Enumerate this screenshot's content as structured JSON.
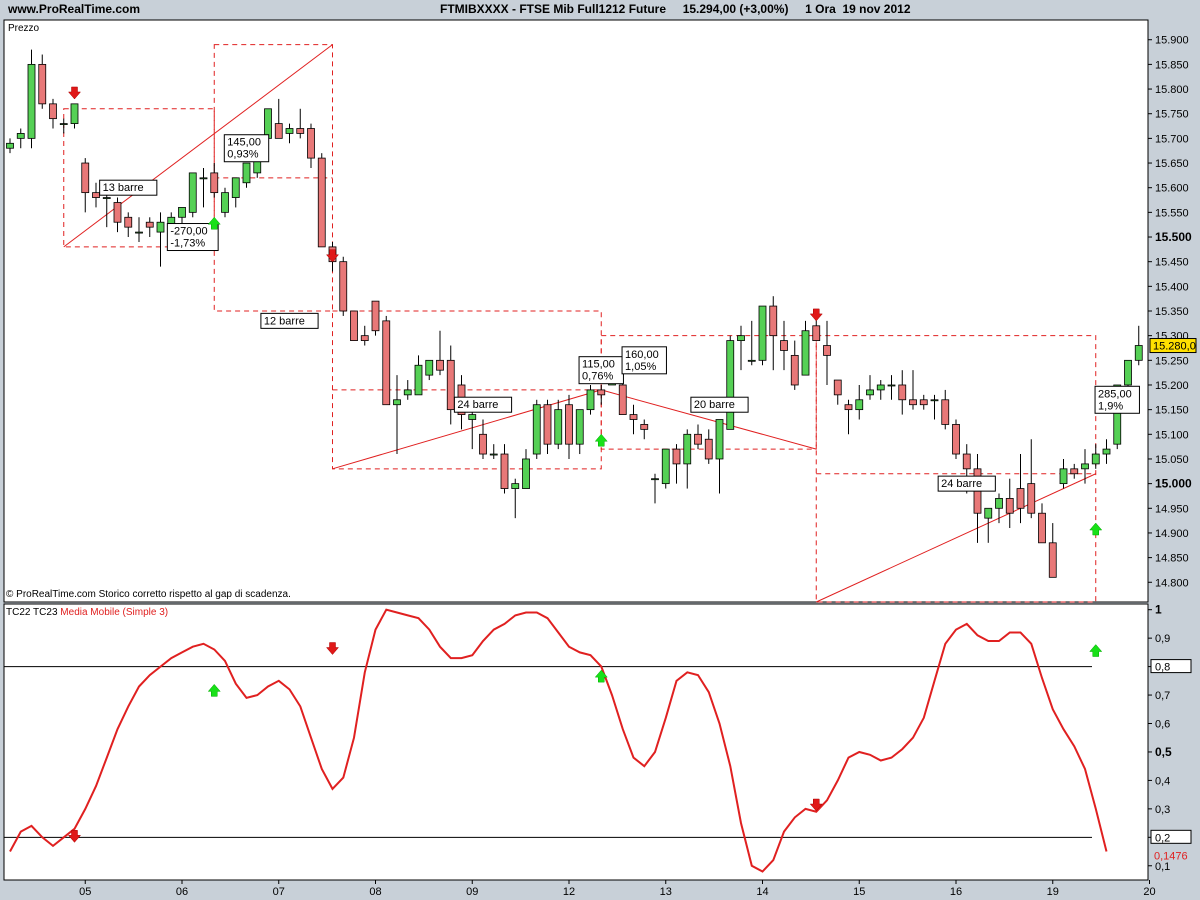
{
  "header": {
    "site": "www.ProRealTime.com",
    "title": "FTMIBXXXX - FTSE Mib Full1212 Future     15.294,00 (+3,00%)     1 Ora  19 nov 2012"
  },
  "colors": {
    "up": "#55d055",
    "down": "#e87878",
    "line": "#e02020",
    "dash": "#e02020",
    "panel": "#ffffff",
    "outer": "#c8d0d8"
  },
  "chart_data": [
    {
      "type": "candlestick",
      "panel_label": "Prezzo",
      "footer_note": "© ProRealTime.com  Storico corretto rispetto al gap di scadenza.",
      "ylim": [
        14760,
        15940
      ],
      "y_ticks": [
        "15.900",
        "15.850",
        "15.800",
        "15.750",
        "15.700",
        "15.650",
        "15.600",
        "15.550",
        "15.500",
        "15.450",
        "15.400",
        "15.350",
        "15.300",
        "15.250",
        "15.200",
        "15.150",
        "15.100",
        "15.050",
        "15.000",
        "14.950",
        "14.900",
        "14.850",
        "14.800"
      ],
      "y_tick_values": [
        15900,
        15850,
        15800,
        15750,
        15700,
        15650,
        15600,
        15550,
        15500,
        15450,
        15400,
        15350,
        15300,
        15250,
        15200,
        15150,
        15100,
        15050,
        15000,
        14950,
        14900,
        14850,
        14800
      ],
      "bold_ticks": [
        "15.500",
        "15.000"
      ],
      "last_price_label": "15.280,0",
      "last_price": 15280,
      "x_labels": [
        "05",
        "06",
        "07",
        "08",
        "09",
        "12",
        "13",
        "14",
        "15",
        "16",
        "19",
        "20"
      ],
      "candles": [
        [
          15680,
          15700,
          15670,
          15690
        ],
        [
          15700,
          15720,
          15680,
          15710
        ],
        [
          15700,
          15880,
          15680,
          15850
        ],
        [
          15850,
          15870,
          15760,
          15770
        ],
        [
          15770,
          15780,
          15720,
          15740
        ],
        [
          15730,
          15740,
          15710,
          15730
        ],
        [
          15730,
          15770,
          15720,
          15770
        ],
        [
          15650,
          15660,
          15550,
          15590
        ],
        [
          15590,
          15610,
          15560,
          15580
        ],
        [
          15580,
          15590,
          15520,
          15580
        ],
        [
          15570,
          15580,
          15510,
          15530
        ],
        [
          15540,
          15550,
          15500,
          15520
        ],
        [
          15510,
          15540,
          15490,
          15510
        ],
        [
          15530,
          15540,
          15500,
          15520
        ],
        [
          15510,
          15550,
          15440,
          15530
        ],
        [
          15520,
          15550,
          15490,
          15540
        ],
        [
          15540,
          15560,
          15520,
          15560
        ],
        [
          15550,
          15620,
          15540,
          15630
        ],
        [
          15620,
          15640,
          15560,
          15620
        ],
        [
          15630,
          15650,
          15580,
          15590
        ],
        [
          15550,
          15600,
          15540,
          15590
        ],
        [
          15580,
          15620,
          15560,
          15620
        ],
        [
          15610,
          15650,
          15600,
          15650
        ],
        [
          15630,
          15690,
          15620,
          15680
        ],
        [
          15700,
          15760,
          15690,
          15760
        ],
        [
          15730,
          15780,
          15700,
          15700
        ],
        [
          15710,
          15730,
          15690,
          15720
        ],
        [
          15720,
          15760,
          15700,
          15710
        ],
        [
          15720,
          15730,
          15640,
          15660
        ],
        [
          15660,
          15670,
          15480,
          15480
        ],
        [
          15480,
          15490,
          15430,
          15450
        ],
        [
          15450,
          15460,
          15340,
          15350
        ],
        [
          15350,
          15350,
          15290,
          15290
        ],
        [
          15300,
          15320,
          15280,
          15290
        ],
        [
          15370,
          15370,
          15300,
          15310
        ],
        [
          15330,
          15340,
          15170,
          15160
        ],
        [
          15160,
          15220,
          15060,
          15170
        ],
        [
          15180,
          15210,
          15170,
          15190
        ],
        [
          15180,
          15260,
          15180,
          15240
        ],
        [
          15220,
          15250,
          15210,
          15250
        ],
        [
          15250,
          15310,
          15220,
          15230
        ],
        [
          15250,
          15280,
          15120,
          15150
        ],
        [
          15200,
          15220,
          15110,
          15140
        ],
        [
          15130,
          15170,
          15070,
          15140
        ],
        [
          15100,
          15130,
          15050,
          15060
        ],
        [
          15060,
          15080,
          15050,
          15060
        ],
        [
          15060,
          15080,
          14980,
          14990
        ],
        [
          14990,
          15010,
          14930,
          15000
        ],
        [
          14990,
          15070,
          14990,
          15050
        ],
        [
          15060,
          15170,
          15050,
          15160
        ],
        [
          15160,
          15170,
          15060,
          15080
        ],
        [
          15080,
          15170,
          15070,
          15150
        ],
        [
          15160,
          15180,
          15050,
          15080
        ],
        [
          15080,
          15120,
          15060,
          15150
        ],
        [
          15150,
          15200,
          15140,
          15190
        ],
        [
          15190,
          15200,
          15160,
          15180
        ],
        [
          15200,
          15240,
          15200,
          15220
        ],
        [
          15200,
          15230,
          15140,
          15140
        ],
        [
          15140,
          15160,
          15100,
          15130
        ],
        [
          15120,
          15130,
          15090,
          15110
        ],
        [
          15010,
          15020,
          14960,
          15010
        ],
        [
          15000,
          15060,
          14990,
          15070
        ],
        [
          15070,
          15080,
          15000,
          15040
        ],
        [
          15040,
          15110,
          14990,
          15100
        ],
        [
          15100,
          15120,
          15070,
          15080
        ],
        [
          15090,
          15110,
          15040,
          15050
        ],
        [
          15050,
          15130,
          14980,
          15130
        ],
        [
          15110,
          15300,
          15110,
          15290
        ],
        [
          15290,
          15320,
          15230,
          15300
        ],
        [
          15250,
          15330,
          15240,
          15250
        ],
        [
          15250,
          15350,
          15240,
          15360
        ],
        [
          15360,
          15380,
          15230,
          15300
        ],
        [
          15290,
          15330,
          15230,
          15270
        ],
        [
          15260,
          15290,
          15190,
          15200
        ],
        [
          15220,
          15330,
          15220,
          15310
        ],
        [
          15320,
          15350,
          15290,
          15290
        ],
        [
          15280,
          15330,
          15200,
          15260
        ],
        [
          15210,
          15210,
          15160,
          15180
        ],
        [
          15160,
          15170,
          15100,
          15150
        ],
        [
          15150,
          15200,
          15130,
          15170
        ],
        [
          15180,
          15220,
          15170,
          15190
        ],
        [
          15190,
          15210,
          15170,
          15200
        ],
        [
          15200,
          15220,
          15170,
          15200
        ],
        [
          15200,
          15230,
          15140,
          15170
        ],
        [
          15170,
          15230,
          15150,
          15160
        ],
        [
          15170,
          15180,
          15150,
          15160
        ],
        [
          15170,
          15180,
          15130,
          15170
        ],
        [
          15170,
          15190,
          15110,
          15120
        ],
        [
          15120,
          15130,
          15050,
          15060
        ],
        [
          15060,
          15080,
          14980,
          15030
        ],
        [
          15030,
          15060,
          14880,
          14940
        ],
        [
          14930,
          14950,
          14880,
          14950
        ],
        [
          14950,
          14980,
          14920,
          14970
        ],
        [
          14970,
          15010,
          14910,
          14940
        ],
        [
          14990,
          15060,
          14920,
          14950
        ],
        [
          15000,
          15090,
          14930,
          14940
        ],
        [
          14940,
          14960,
          14880,
          14880
        ],
        [
          14880,
          14920,
          14830,
          14810
        ],
        [
          15000,
          15050,
          14990,
          15030
        ],
        [
          15030,
          15040,
          15010,
          15020
        ],
        [
          15030,
          15070,
          15000,
          15040
        ],
        [
          15040,
          15080,
          15030,
          15060
        ],
        [
          15060,
          15090,
          15040,
          15070
        ],
        [
          15080,
          15200,
          15070,
          15200
        ],
        [
          15200,
          15250,
          15190,
          15250
        ],
        [
          15250,
          15320,
          15240,
          15280
        ]
      ],
      "annotations": [
        {
          "lines": [
            "13 barre"
          ]
        },
        {
          "lines": [
            "145,00",
            "0,93%"
          ]
        },
        {
          "lines": [
            "-270,00",
            "-1,73%"
          ]
        },
        {
          "lines": [
            "12 barre"
          ]
        },
        {
          "lines": [
            "115,00",
            "0,76%"
          ]
        },
        {
          "lines": [
            "160,00",
            "1,05%"
          ]
        },
        {
          "lines": [
            "24 barre"
          ]
        },
        {
          "lines": [
            "20 barre"
          ]
        },
        {
          "lines": [
            "285,00",
            "1,9%"
          ]
        },
        {
          "lines": [
            "24 barre"
          ]
        }
      ],
      "ann_pos": [
        [
          15600
        ],
        [
          15680
        ],
        [
          15500
        ],
        [
          15330
        ],
        [
          15230
        ],
        [
          15250
        ],
        [
          15160
        ],
        [
          15160
        ],
        [
          15170
        ],
        [
          15000
        ]
      ],
      "ann_bar": [
        11,
        22,
        17,
        26,
        55,
        59,
        44,
        66,
        103,
        89
      ],
      "trend_lines": [
        {
          "x": [
            5,
            30
          ],
          "y": [
            15480,
            15890
          ]
        },
        {
          "x": [
            30,
            55
          ],
          "y": [
            15030,
            15190
          ]
        },
        {
          "x": [
            55,
            75
          ],
          "y": [
            15190,
            15070
          ]
        },
        {
          "x": [
            75,
            101
          ],
          "y": [
            14760,
            15020
          ]
        }
      ],
      "rect_boxes": [
        {
          "x": [
            5,
            19
          ],
          "y": [
            15480,
            15760
          ]
        },
        {
          "x": [
            19,
            30
          ],
          "y": [
            15350,
            15890
          ]
        },
        {
          "x": [
            30,
            55
          ],
          "y": [
            15030,
            15350
          ]
        },
        {
          "x": [
            55,
            75
          ],
          "y": [
            15070,
            15300
          ]
        },
        {
          "x": [
            75,
            101
          ],
          "y": [
            14760,
            15300
          ]
        }
      ],
      "hlines": [
        {
          "x": [
            19,
            30
          ],
          "y": 15620
        },
        {
          "x": [
            30,
            55
          ],
          "y": 15190
        },
        {
          "x": [
            75,
            101
          ],
          "y": 15020
        }
      ],
      "signal_arrows_down": [
        [
          6,
          15790
        ],
        [
          30,
          15460
        ],
        [
          75,
          15340
        ]
      ],
      "signal_arrows_up": [
        [
          19,
          15530
        ],
        [
          55,
          15090
        ],
        [
          101,
          14910
        ]
      ]
    },
    {
      "type": "line",
      "label_prefix": "TC22 TC23 ",
      "series_name": "Media Mobile (Simple 3)",
      "ylim": [
        0.05,
        1.02
      ],
      "y_ticks": [
        "1",
        "0,9",
        "0,8",
        "0,7",
        "0,6",
        "0,5",
        "0,4",
        "0,3",
        "0,2",
        "0,1"
      ],
      "y_tick_values": [
        1,
        0.9,
        0.8,
        0.7,
        0.6,
        0.5,
        0.4,
        0.3,
        0.2,
        0.1
      ],
      "bold_ticks": [
        "1",
        "0,5"
      ],
      "boxed_ticks": [
        "0,8",
        "0,2"
      ],
      "hlines": [
        0.8,
        0.2
      ],
      "last_value_label": "0,1476",
      "values": [
        0.15,
        0.22,
        0.24,
        0.2,
        0.17,
        0.2,
        0.23,
        0.3,
        0.38,
        0.48,
        0.58,
        0.66,
        0.73,
        0.77,
        0.8,
        0.83,
        0.85,
        0.87,
        0.88,
        0.86,
        0.82,
        0.74,
        0.69,
        0.7,
        0.73,
        0.75,
        0.72,
        0.66,
        0.55,
        0.44,
        0.37,
        0.41,
        0.55,
        0.78,
        0.93,
        1.0,
        0.99,
        0.98,
        0.97,
        0.93,
        0.87,
        0.83,
        0.83,
        0.84,
        0.89,
        0.93,
        0.95,
        0.98,
        0.99,
        0.99,
        0.97,
        0.92,
        0.87,
        0.85,
        0.84,
        0.8,
        0.7,
        0.58,
        0.48,
        0.45,
        0.5,
        0.62,
        0.75,
        0.78,
        0.77,
        0.71,
        0.6,
        0.45,
        0.25,
        0.1,
        0.08,
        0.12,
        0.22,
        0.27,
        0.3,
        0.29,
        0.33,
        0.4,
        0.48,
        0.5,
        0.49,
        0.47,
        0.48,
        0.51,
        0.55,
        0.62,
        0.75,
        0.88,
        0.93,
        0.95,
        0.91,
        0.89,
        0.89,
        0.92,
        0.92,
        0.88,
        0.76,
        0.65,
        0.58,
        0.52,
        0.44,
        0.3,
        0.15
      ],
      "signal_arrows_down": [
        [
          6,
          0.2
        ],
        [
          30,
          0.86
        ],
        [
          75,
          0.31
        ]
      ],
      "signal_arrows_up": [
        [
          19,
          0.72
        ],
        [
          55,
          0.77
        ],
        [
          101,
          0.86
        ]
      ]
    }
  ]
}
